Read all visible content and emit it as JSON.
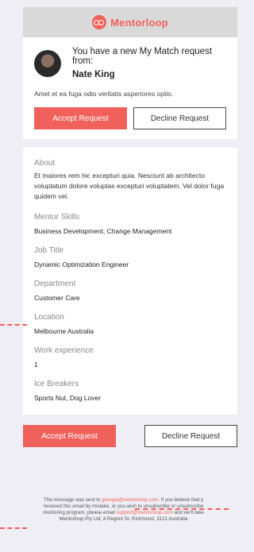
{
  "brand": {
    "name": "Mentorloop"
  },
  "request": {
    "headline": "You have a new My Match request from:",
    "name": "Nate King",
    "message": "Amet et ea fuga odio veritatis asperiores optio.",
    "accept_label": "Accept Request",
    "decline_label": "Decline Request"
  },
  "profile": {
    "about_title": "About",
    "about_text": "Et maiores rem hic excepturi quia. Nesciunt ab architecto voluptatum dolore voluptas excepturi voluptatem. Vel dolor fuga quidem vel.",
    "fields": [
      {
        "label": "Mentor Skills",
        "value": "Business Development, Change Management"
      },
      {
        "label": "Job Title",
        "value": "Dynamic Optimization Engineer"
      },
      {
        "label": "Department",
        "value": "Customer Care"
      },
      {
        "label": "Location",
        "value": "Melbourne Australia"
      },
      {
        "label": "Work experience",
        "value": "1"
      },
      {
        "label": "Ice Breakers",
        "value": "Sports Nut, Dog Lover"
      }
    ]
  },
  "bottom_actions": {
    "accept_label": "Accept Request",
    "decline_label": "Decline Request"
  },
  "footer": {
    "line1_pre": "This message was sent to ",
    "line1_email": "georgia@mentorloop.com",
    "line1_post": ". If you believe that y",
    "line2": "received this email by mistake, or you wish to unsubscribe or unsubscribe",
    "line3_pre": "mentoring program, please email ",
    "line3_email": "support@mentorloop.com",
    "line3_post": " and we'll take",
    "line4": "Mentorloop Pty Ltd, 4 Regent St. Richmond, 3121 Australia"
  },
  "colors": {
    "accent": "#f0615c",
    "header_bg": "#d9d9d9",
    "page_bg": "#efeef4"
  }
}
